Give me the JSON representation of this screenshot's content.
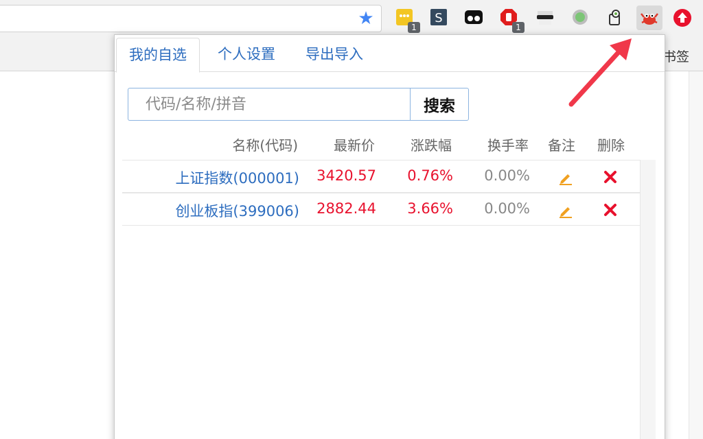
{
  "toolbar": {
    "star_icon": "bookmark-star-icon",
    "extensions": [
      {
        "icon": "notes-extension-icon",
        "badge": "1"
      },
      {
        "icon": "s-extension-icon",
        "badge": ""
      },
      {
        "icon": "glasses-extension-icon",
        "badge": ""
      },
      {
        "icon": "stop-hand-extension-icon",
        "badge": "1"
      },
      {
        "icon": "spy-extension-icon",
        "badge": ""
      },
      {
        "icon": "green-circle-extension-icon",
        "badge": ""
      },
      {
        "icon": "key-extension-icon",
        "badge": ""
      },
      {
        "icon": "crab-extension-icon",
        "badge": ""
      },
      {
        "icon": "red-upload-extension-icon",
        "badge": ""
      }
    ]
  },
  "bookmarks": {
    "label": "书签"
  },
  "popup": {
    "tabs": [
      {
        "label": "我的自选",
        "active": true
      },
      {
        "label": "个人设置",
        "active": false
      },
      {
        "label": "导出导入",
        "active": false
      }
    ],
    "search": {
      "placeholder": "代码/名称/拼音",
      "value": "",
      "button_label": "搜索"
    },
    "headers": {
      "name": "名称(代码)",
      "price": "最新价",
      "change": "涨跌幅",
      "turnover": "换手率",
      "note": "备注",
      "delete": "删除"
    },
    "rows": [
      {
        "name": "上证指数(000001)",
        "price": "3420.57",
        "change": "0.76%",
        "turnover": "0.00%"
      },
      {
        "name": "创业板指(399006)",
        "price": "2882.44",
        "change": "3.66%",
        "turnover": "0.00%"
      }
    ]
  },
  "colors": {
    "link_blue": "#2d6dbf",
    "rise_red": "#e8112d",
    "arrow_red": "#f0384a",
    "edit_orange": "#f0a020",
    "delete_red": "#e8112d"
  }
}
